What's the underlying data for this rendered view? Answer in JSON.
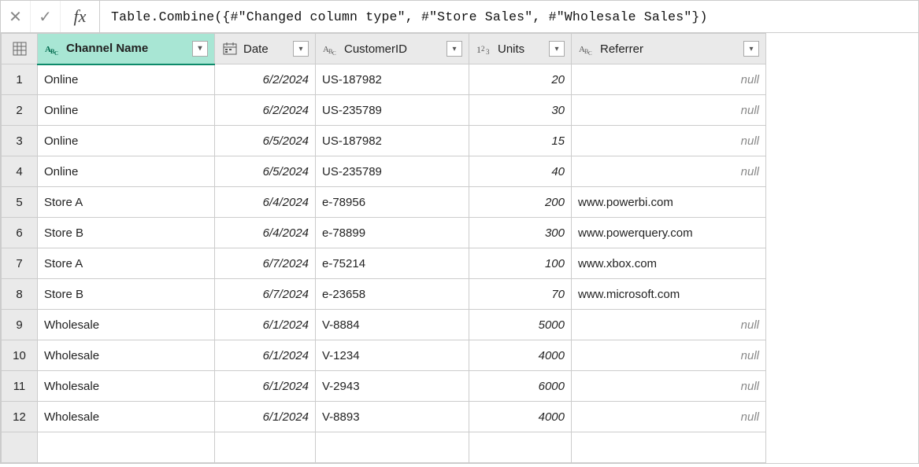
{
  "formula_bar": {
    "cancel_symbol": "✕",
    "confirm_symbol": "✓",
    "fx_label": "fx",
    "formula": "Table.Combine({#\"Changed column type\", #\"Store Sales\", #\"Wholesale Sales\"})"
  },
  "columns": {
    "channel": "Channel Name",
    "date": "Date",
    "customer": "CustomerID",
    "units": "Units",
    "referrer": "Referrer"
  },
  "rows": [
    {
      "n": "1",
      "channel": "Online",
      "date": "6/2/2024",
      "customer": "US-187982",
      "units": "20",
      "referrer": null
    },
    {
      "n": "2",
      "channel": "Online",
      "date": "6/2/2024",
      "customer": "US-235789",
      "units": "30",
      "referrer": null
    },
    {
      "n": "3",
      "channel": "Online",
      "date": "6/5/2024",
      "customer": "US-187982",
      "units": "15",
      "referrer": null
    },
    {
      "n": "4",
      "channel": "Online",
      "date": "6/5/2024",
      "customer": "US-235789",
      "units": "40",
      "referrer": null
    },
    {
      "n": "5",
      "channel": "Store A",
      "date": "6/4/2024",
      "customer": "e-78956",
      "units": "200",
      "referrer": "www.powerbi.com"
    },
    {
      "n": "6",
      "channel": "Store B",
      "date": "6/4/2024",
      "customer": "e-78899",
      "units": "300",
      "referrer": "www.powerquery.com"
    },
    {
      "n": "7",
      "channel": "Store A",
      "date": "6/7/2024",
      "customer": "e-75214",
      "units": "100",
      "referrer": "www.xbox.com"
    },
    {
      "n": "8",
      "channel": "Store B",
      "date": "6/7/2024",
      "customer": "e-23658",
      "units": "70",
      "referrer": "www.microsoft.com"
    },
    {
      "n": "9",
      "channel": "Wholesale",
      "date": "6/1/2024",
      "customer": "V-8884",
      "units": "5000",
      "referrer": null
    },
    {
      "n": "10",
      "channel": "Wholesale",
      "date": "6/1/2024",
      "customer": "V-1234",
      "units": "4000",
      "referrer": null
    },
    {
      "n": "11",
      "channel": "Wholesale",
      "date": "6/1/2024",
      "customer": "V-2943",
      "units": "6000",
      "referrer": null
    },
    {
      "n": "12",
      "channel": "Wholesale",
      "date": "6/1/2024",
      "customer": "V-8893",
      "units": "4000",
      "referrer": null
    }
  ],
  "null_label": "null",
  "dropdown_glyph": "▾"
}
